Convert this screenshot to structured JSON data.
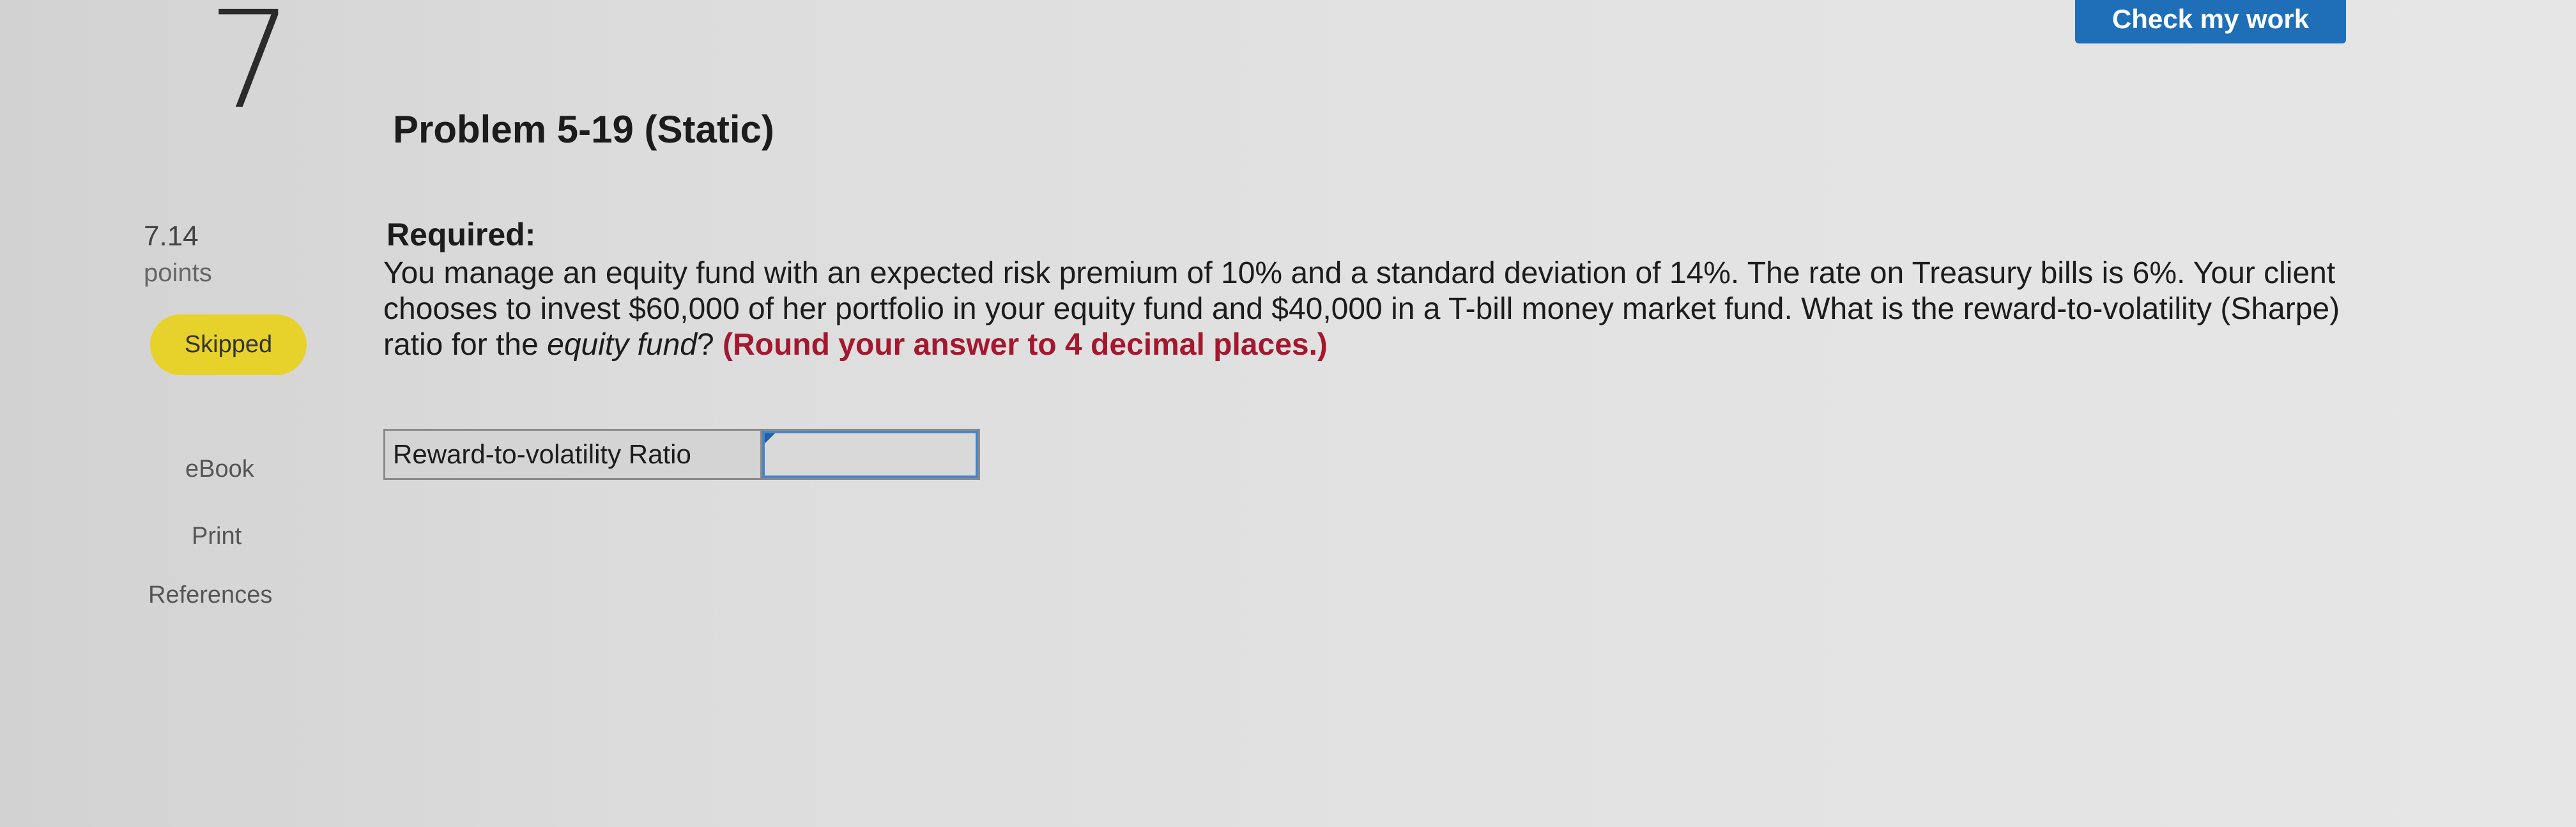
{
  "question": {
    "number": "7",
    "points_value": "7.14",
    "points_label": "points",
    "status": "Skipped"
  },
  "sidebar": {
    "links": [
      "eBook",
      "Print",
      "References"
    ]
  },
  "header": {
    "check_button_label": "Check my work"
  },
  "problem": {
    "title": "Problem 5-19 (Static)",
    "required_label": "Required:",
    "text_main": "You manage an equity fund with an expected risk premium of 10% and a standard deviation of 14%. The rate on Treasury bills is 6%. Your client chooses to invest $60,000 of her portfolio in your equity fund and $40,000 in a T-bill money market fund. What is the reward-to-volatility (Sharpe) ratio for the ",
    "text_emphasis": "equity fund",
    "text_end": "? ",
    "round_note": "(Round your answer to 4 decimal places.)"
  },
  "answer": {
    "label": "Reward-to-volatility Ratio",
    "value": ""
  },
  "colors": {
    "skipped_badge": "#e6d22a",
    "check_button": "#1e6fb8",
    "round_note": "#a3182f",
    "input_border": "#4a84c4"
  }
}
